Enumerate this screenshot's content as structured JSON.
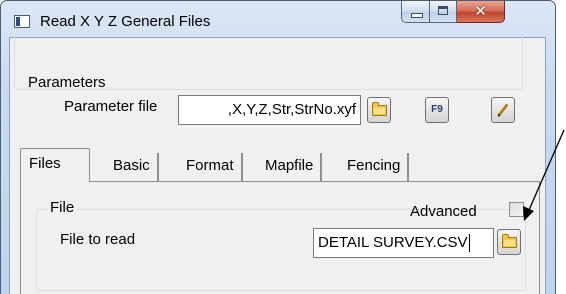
{
  "window": {
    "title": "Read X Y Z General Files"
  },
  "parameters": {
    "group_label": "Parameters",
    "file_label": "Parameter file",
    "file_value": ",X,Y,Z,Str,StrNo.xyf",
    "f9_label": "F9"
  },
  "tabs": [
    {
      "label": "Files",
      "active": true
    },
    {
      "label": "Basic",
      "active": false
    },
    {
      "label": "Format",
      "active": false
    },
    {
      "label": "Mapfile",
      "active": false
    },
    {
      "label": "Fencing",
      "active": false
    }
  ],
  "file_group": {
    "group_label": "File",
    "advanced_label": "Advanced",
    "advanced_checked": false,
    "read_label": "File to read",
    "read_value": "DETAIL SURVEY.CSV"
  },
  "colors": {
    "annotation_arrow": "#000000",
    "folder_icon": "#f5c74c",
    "close_button": "#c2452a"
  }
}
